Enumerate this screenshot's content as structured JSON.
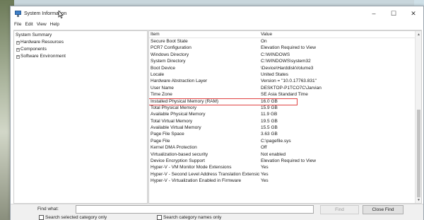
{
  "window": {
    "title": "System Information",
    "controls": {
      "minimize": "–",
      "maximize": "☐",
      "close": "✕"
    }
  },
  "menu": [
    "File",
    "Edit",
    "View",
    "Help"
  ],
  "tree": {
    "root": "System Summary",
    "children": [
      {
        "label": "Hardware Resources",
        "expander": "+"
      },
      {
        "label": "Components",
        "expander": "+"
      },
      {
        "label": "Software Environment",
        "expander": "+"
      }
    ]
  },
  "list": {
    "headers": {
      "item": "Item",
      "value": "Value"
    },
    "rows": [
      {
        "item": "Secure Boot State",
        "value": "On"
      },
      {
        "item": "PCR7 Configuration",
        "value": "Elevation Required to View"
      },
      {
        "item": "Windows Directory",
        "value": "C:\\WINDOWS"
      },
      {
        "item": "System Directory",
        "value": "C:\\WINDOWS\\system32"
      },
      {
        "item": "Boot Device",
        "value": "\\Device\\HarddiskVolume3"
      },
      {
        "item": "Locale",
        "value": "United States"
      },
      {
        "item": "Hardware Abstraction Layer",
        "value": "Version = \"10.0.17763.831\""
      },
      {
        "item": "User Name",
        "value": "DESKTOP-P1TCO7C\\Jarvian"
      },
      {
        "item": "Time Zone",
        "value": "SE Asia Standard Time"
      },
      {
        "item": "Installed Physical Memory (RAM)",
        "value": "16.0 GB",
        "highlighted": true
      },
      {
        "item": "Total Physical Memory",
        "value": "15.9 GB"
      },
      {
        "item": "Available Physical Memory",
        "value": "11.9 GB"
      },
      {
        "item": "Total Virtual Memory",
        "value": "19.5 GB"
      },
      {
        "item": "Available Virtual Memory",
        "value": "15.5 GB"
      },
      {
        "item": "Page File Space",
        "value": "3.63 GB"
      },
      {
        "item": "Page File",
        "value": "C:\\pagefile.sys"
      },
      {
        "item": "Kernel DMA Protection",
        "value": "Off"
      },
      {
        "item": "Virtualization-based security",
        "value": "Not enabled"
      },
      {
        "item": "Device Encryption Support",
        "value": "Elevation Required to View"
      },
      {
        "item": "Hyper-V - VM Monitor Mode Extensions",
        "value": "Yes"
      },
      {
        "item": "Hyper-V - Second Level Address Translation Extensions",
        "value": "Yes"
      },
      {
        "item": "Hyper-V - Virtualization Enabled in Firmware",
        "value": "Yes"
      }
    ]
  },
  "find": {
    "label": "Find what:",
    "input_value": "",
    "find_button": "Find",
    "close_button": "Close Find",
    "option_selected_category": "Search selected category only",
    "option_category_names": "Search category names only"
  },
  "colors": {
    "highlight_border": "#e04343",
    "window_bg": "#ffffff",
    "findbar_bg": "#f0f0f0"
  }
}
